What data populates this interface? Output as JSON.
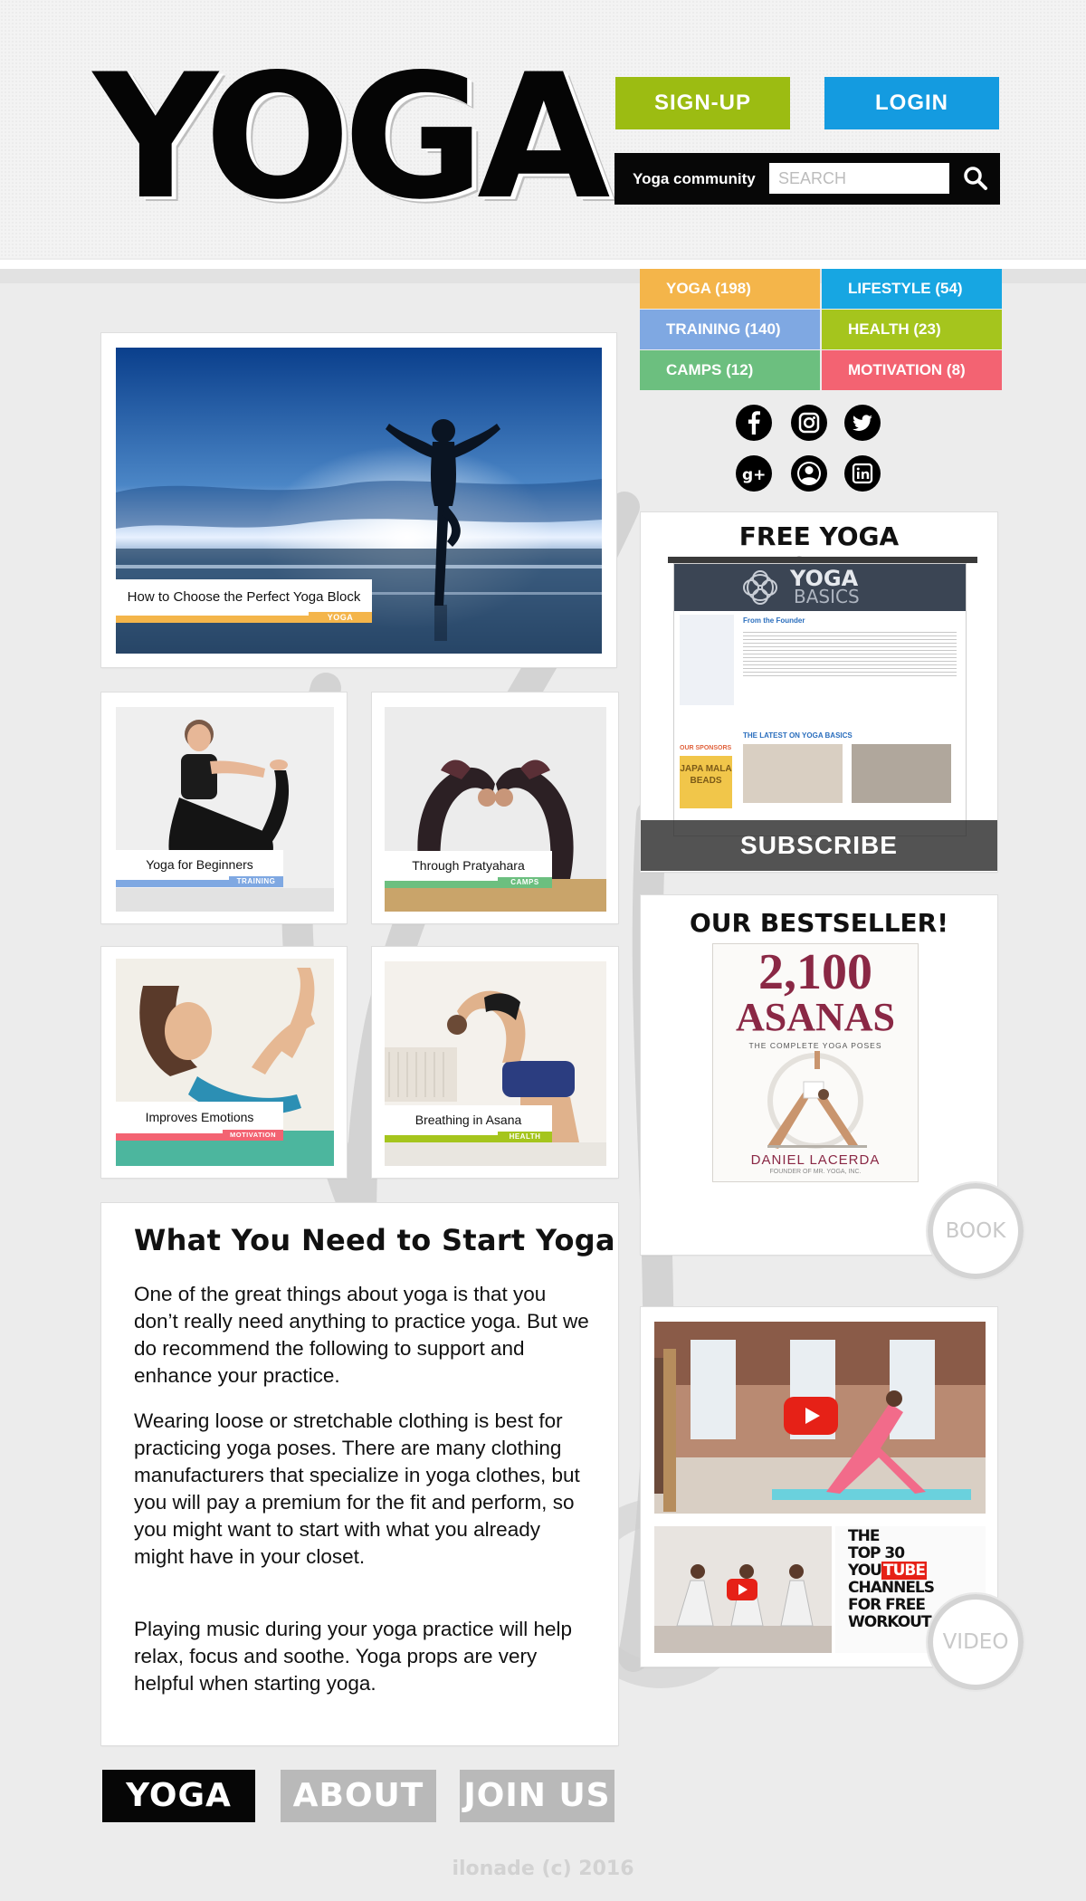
{
  "header": {
    "logo": "YOGA",
    "signup_label": "SIGN-UP",
    "login_label": "LOGIN",
    "search_label": "Yoga community",
    "search_placeholder": "SEARCH"
  },
  "categories": [
    {
      "label": "YOGA (198)",
      "color": "#f4b54a"
    },
    {
      "label": "LIFESTYLE (54)",
      "color": "#17a6e2"
    },
    {
      "label": "TRAINING (140)",
      "color": "#7fa8e2"
    },
    {
      "label": "HEALTH (23)",
      "color": "#a5c51d"
    },
    {
      "label": "CAMPS (12)",
      "color": "#6cbf7f"
    },
    {
      "label": "MOTIVATION (8)",
      "color": "#f36372"
    }
  ],
  "social": [
    "facebook-icon",
    "instagram-icon",
    "twitter-icon",
    "google-plus-icon",
    "profile-icon",
    "linkedin-icon"
  ],
  "posts": {
    "featured": {
      "caption": "How to Choose the Perfect Yoga Block",
      "tag": "YOGA",
      "color": "#f4b54a"
    },
    "p1": {
      "caption": "Yoga for Beginners",
      "tag": "TRAINING",
      "color": "#7fa8e2"
    },
    "p2": {
      "caption": "Through Pratyahara",
      "tag": "CAMPS",
      "color": "#6cbf7f"
    },
    "p3": {
      "caption": "Improves Emotions",
      "tag": "MOTIVATION",
      "color": "#f36372"
    },
    "p4": {
      "caption": "Breathing in Asana",
      "tag": "HEALTH",
      "color": "#a5c51d"
    }
  },
  "article": {
    "title": "What You Need to Start Yoga",
    "p1": "One of the great things about yoga is that you don’t really need anything to practice yoga. But we do recommend the following to support and enhance your practice.",
    "p2": "Wearing loose or stretchable clothing is best for practicing yoga poses. There are many clothing manufacturers that specialize in yoga clothes, but you will pay a premium for the fit and perform, so you might want to start with what you already might have in your closet.",
    "p3": "Playing music during your yoga practice will help relax, focus and soothe. Yoga props are very helpful when starting yoga."
  },
  "newsletter": {
    "title": "FREE YOGA NEWSLETTER",
    "preview_brand": "YOGA",
    "preview_brand2": "BASICS",
    "preview_heading": "From the Founder",
    "preview_latest": "THE LATEST ON YOGA BASICS",
    "preview_sponsors": "OUR SPONSORS",
    "preview_sponsor_name": "JAPA MALA BEADS",
    "subscribe_label": "SUBSCRIBE"
  },
  "bestseller": {
    "title": "OUR BESTSELLER!",
    "book_number": "2,100",
    "book_title": "ASANAS",
    "book_subtitle": "THE COMPLETE YOGA POSES",
    "author": "DANIEL LACERDA",
    "author_note": "FOUNDER OF MR. YOGA, INC.",
    "button": "BOOK"
  },
  "video": {
    "thumb2_text": [
      "THE",
      "TOP 30",
      "YOU",
      "TUBE",
      "CHANNELS",
      "FOR FREE",
      "WORKOUT"
    ],
    "button": "VIDEO"
  },
  "nav": [
    "YOGA",
    "ABOUT",
    "JOIN US"
  ],
  "footer": "ilonade (c) 2016"
}
